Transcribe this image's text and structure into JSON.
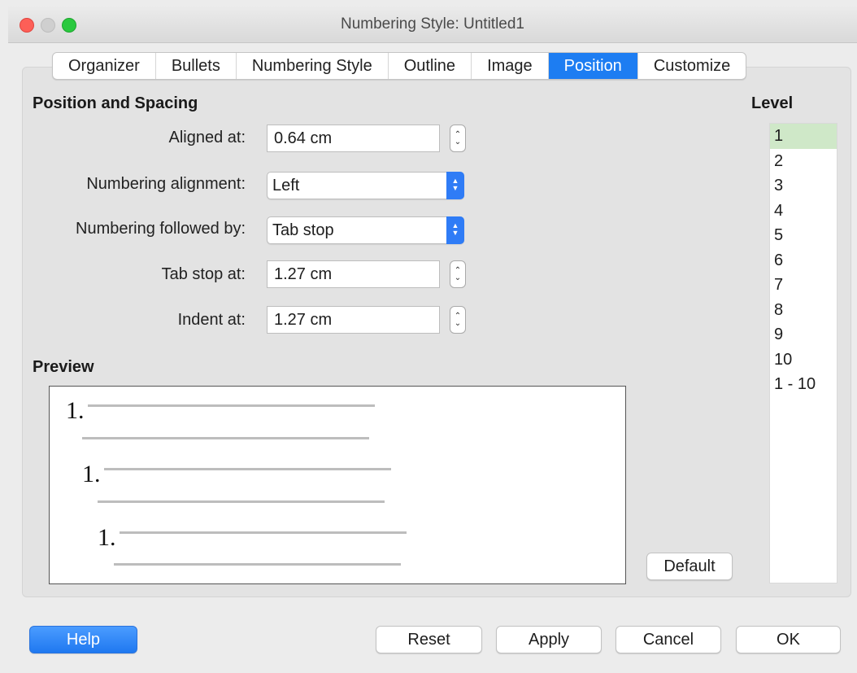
{
  "window": {
    "title": "Numbering Style: Untitled1"
  },
  "tabs": [
    "Organizer",
    "Bullets",
    "Numbering Style",
    "Outline",
    "Image",
    "Position",
    "Customize"
  ],
  "active_tab": "Position",
  "position_spacing": {
    "heading": "Position and Spacing",
    "aligned_at_label": "Aligned at:",
    "aligned_at_value": "0.64 cm",
    "numbering_alignment_label": "Numbering alignment:",
    "numbering_alignment_value": "Left",
    "numbering_followed_by_label": "Numbering followed by:",
    "numbering_followed_by_value": "Tab stop",
    "tab_stop_at_label": "Tab stop at:",
    "tab_stop_at_value": "1.27 cm",
    "indent_at_label": "Indent at:",
    "indent_at_value": "1.27 cm"
  },
  "preview": {
    "heading": "Preview",
    "numbers": [
      "1.",
      "1.",
      "1."
    ]
  },
  "level": {
    "heading": "Level",
    "items": [
      "1",
      "2",
      "3",
      "4",
      "5",
      "6",
      "7",
      "8",
      "9",
      "10",
      "1 - 10"
    ],
    "selected": "1"
  },
  "buttons": {
    "default": "Default",
    "help": "Help",
    "reset": "Reset",
    "apply": "Apply",
    "cancel": "Cancel",
    "ok": "OK"
  },
  "colors": {
    "accent": "#1d7df2",
    "selected_level": "#cfe8c8"
  }
}
